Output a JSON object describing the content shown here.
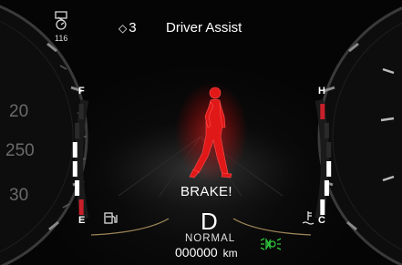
{
  "header": {
    "page_indicator_arrows": "◇",
    "page_number": "3",
    "title": "Driver Assist"
  },
  "speed_limit": {
    "value": "116",
    "icon": "speed-limit-sign-icon"
  },
  "alert": {
    "message": "BRAKE!",
    "icon": "pedestrian-walking-icon",
    "color": "#e01818"
  },
  "fuel_gauge": {
    "full_label": "F",
    "empty_label": "E",
    "icon": "fuel-pump-icon",
    "level": 0.7
  },
  "temp_gauge": {
    "hot_label": "H",
    "cold_label": "C",
    "icon": "coolant-temperature-icon",
    "level": 0.55
  },
  "center": {
    "gear": "D",
    "drive_mode": "NORMAL",
    "odometer": "000000",
    "odometer_unit": "km"
  },
  "indicators": {
    "lights_icon": "position-lights-icon",
    "lights_color": "#2ec23a"
  },
  "speedometer": {
    "labels": [
      "20",
      "250",
      "30"
    ]
  },
  "tachometer": {
    "labels": [
      "",
      "",
      ""
    ]
  },
  "colors": {
    "alert_red": "#e01818",
    "gauge_white": "#ffffff",
    "gauge_red": "#c8202a"
  }
}
